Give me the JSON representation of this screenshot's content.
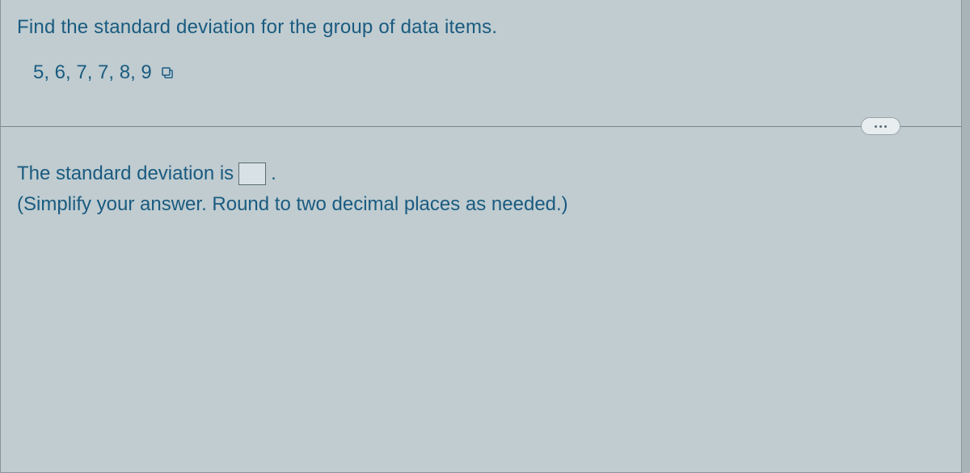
{
  "question": {
    "instruction": "Find the standard deviation for the group of data items.",
    "data_items": "5, 6, 7, 7, 8, 9"
  },
  "answer": {
    "prefix": "The standard deviation is",
    "suffix": ".",
    "input_value": "",
    "hint": "(Simplify your answer. Round to two decimal places as needed.)"
  },
  "icons": {
    "copy": "copy-icon",
    "more": "more-options"
  }
}
